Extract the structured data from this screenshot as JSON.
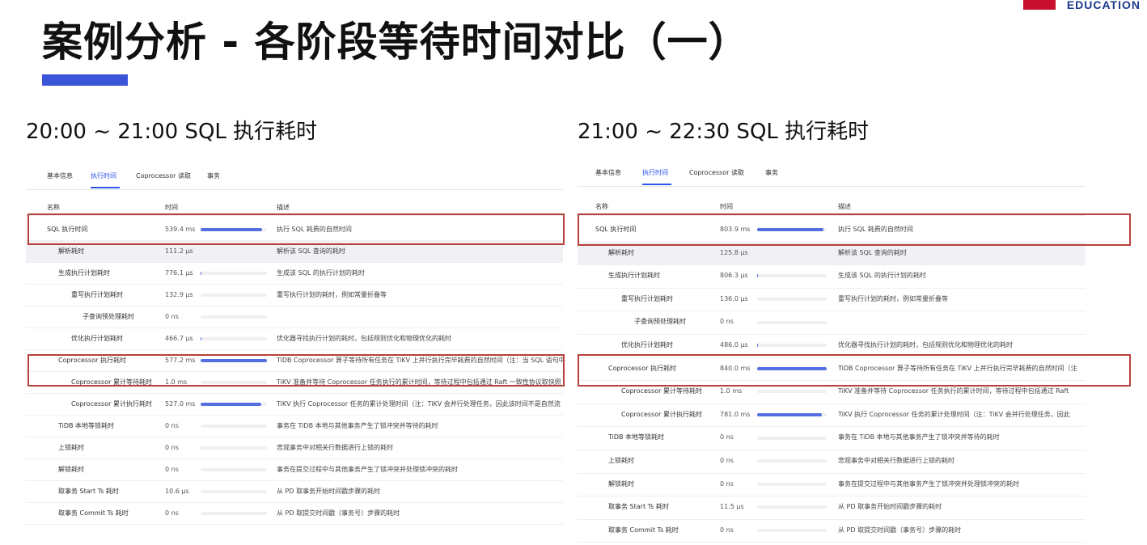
{
  "slide": {
    "title": "案例分析 - 各阶段等待时间对比（一）",
    "brand": "EDUCATION",
    "accent_color": "#3b55d9",
    "highlight_color": "#b8403a"
  },
  "left": {
    "heading": "20:00 ~ 21:00 SQL 执行耗时",
    "tabs": [
      "基本信息",
      "执行时间",
      "Coprocessor 读取",
      "事务"
    ],
    "active_tab": "执行时间",
    "columns": {
      "name": "名称",
      "time": "时间",
      "desc": "描述"
    },
    "rows": [
      {
        "name": "SQL 执行时间",
        "time": "539.4 ms",
        "bar": 0.93,
        "desc": "执行 SQL 耗费的自然时间"
      },
      {
        "name": "解析耗时",
        "time": "111.2 µs",
        "bar": 0.0,
        "desc": "解析该 SQL 查询的耗时"
      },
      {
        "name": "生成执行计划耗时",
        "time": "776.1 µs",
        "bar": 0.01,
        "desc": "生成该 SQL 的执行计划的耗时"
      },
      {
        "name": "重写执行计划耗时",
        "time": "132.9 µs",
        "bar": 0.0,
        "desc": "重写执行计划的耗时，例如常量折叠等"
      },
      {
        "name": "子查询预处理耗时",
        "time": "0 ns",
        "bar": 0.0,
        "desc": ""
      },
      {
        "name": "优化执行计划耗时",
        "time": "466.7 µs",
        "bar": 0.01,
        "desc": "优化器寻找执行计划的耗时，包括规则优化和物理优化的耗时"
      },
      {
        "name": "Coprocessor 执行耗时",
        "time": "577.2 ms",
        "bar": 1.0,
        "desc": "TiDB Coprocessor 算子等待所有任务在 TiKV 上并行执行完毕耗费的自然时间（注：当 SQL 语句中"
      },
      {
        "name": "Coprocessor 累计等待耗时",
        "time": "1.0 ms",
        "bar": 0.0,
        "desc": "TiKV 准备并等待 Coprocessor 任务执行的累计时间，等待过程中包括通过 Raft 一致性协议取快照"
      },
      {
        "name": "Coprocessor 累计执行耗时",
        "time": "527.0 ms",
        "bar": 0.91,
        "desc": "TiKV 执行 Coprocessor 任务的累计处理时间（注：TiKV 会并行处理任务，因此该时间不是自然流"
      },
      {
        "name": "TiDB 本地等锁耗时",
        "time": "0 ns",
        "bar": 0.0,
        "desc": "事务在 TiDB 本地与其他事务产生了锁冲突并等待的耗时"
      },
      {
        "name": "上锁耗时",
        "time": "0 ns",
        "bar": 0.0,
        "desc": "悲观事务中对相关行数据进行上锁的耗时"
      },
      {
        "name": "解锁耗时",
        "time": "0 ns",
        "bar": 0.0,
        "desc": "事务在提交过程中与其他事务产生了锁冲突并处理锁冲突的耗时"
      },
      {
        "name": "取事务 Start Ts 耗时",
        "time": "10.6 µs",
        "bar": 0.0,
        "desc": "从 PD 取事务开始时间戳步骤的耗时"
      },
      {
        "name": "取事务 Commit Ts 耗时",
        "time": "0 ns",
        "bar": 0.0,
        "desc": "从 PD 取提交时间戳（事务号）步骤的耗时"
      }
    ]
  },
  "right": {
    "heading": "21:00 ~ 22:30 SQL 执行耗时",
    "tabs": [
      "基本信息",
      "执行时间",
      "Coprocessor 读取",
      "事务"
    ],
    "active_tab": "执行时间",
    "columns": {
      "name": "名称",
      "time": "时间",
      "desc": "描述"
    },
    "rows": [
      {
        "name": "SQL 执行时间",
        "time": "803.9 ms",
        "bar": 0.95,
        "desc": "执行 SQL 耗费的自然时间"
      },
      {
        "name": "解析耗时",
        "time": "125.8 µs",
        "bar": 0.0,
        "desc": "解析该 SQL 查询的耗时"
      },
      {
        "name": "生成执行计划耗时",
        "time": "806.3 µs",
        "bar": 0.01,
        "desc": "生成该 SQL 的执行计划的耗时"
      },
      {
        "name": "重写执行计划耗时",
        "time": "136.0 µs",
        "bar": 0.0,
        "desc": "重写执行计划的耗时，例如常量折叠等"
      },
      {
        "name": "子查询预处理耗时",
        "time": "0 ns",
        "bar": 0.0,
        "desc": ""
      },
      {
        "name": "优化执行计划耗时",
        "time": "486.0 µs",
        "bar": 0.01,
        "desc": "优化器寻找执行计划的耗时，包括规则优化和物理优化的耗时"
      },
      {
        "name": "Coprocessor 执行耗时",
        "time": "840.0 ms",
        "bar": 1.0,
        "desc": "TiDB Coprocessor 算子等待所有任务在 TiKV 上并行执行完毕耗费的自然时间（注"
      },
      {
        "name": "Coprocessor 累计等待耗时",
        "time": "1.0 ms",
        "bar": 0.0,
        "desc": "TiKV 准备并等待 Coprocessor 任务执行的累计时间，等待过程中包括通过 Raft"
      },
      {
        "name": "Coprocessor 累计执行耗时",
        "time": "781.0 ms",
        "bar": 0.93,
        "desc": "TiKV 执行 Coprocessor 任务的累计处理时间（注：TiKV 会并行处理任务，因此"
      },
      {
        "name": "TiDB 本地等锁耗时",
        "time": "0 ns",
        "bar": 0.0,
        "desc": "事务在 TiDB 本地与其他事务产生了锁冲突并等待的耗时"
      },
      {
        "name": "上锁耗时",
        "time": "0 ns",
        "bar": 0.0,
        "desc": "悲观事务中对相关行数据进行上锁的耗时"
      },
      {
        "name": "解锁耗时",
        "time": "0 ns",
        "bar": 0.0,
        "desc": "事务在提交过程中与其他事务产生了锁冲突并处理锁冲突的耗时"
      },
      {
        "name": "取事务 Start Ts 耗时",
        "time": "11.5 µs",
        "bar": 0.0,
        "desc": "从 PD 取事务开始时间戳步骤的耗时"
      },
      {
        "name": "取事务 Commit Ts 耗时",
        "time": "0 ns",
        "bar": 0.0,
        "desc": "从 PD 取提交时间戳（事务号）步骤的耗时"
      }
    ]
  }
}
